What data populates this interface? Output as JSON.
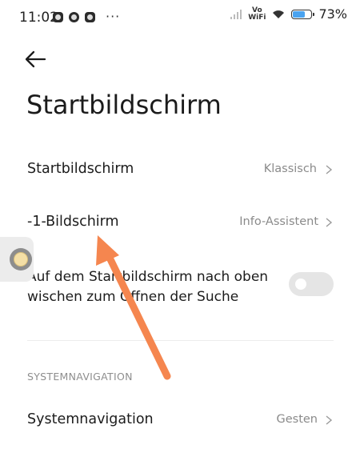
{
  "status_bar": {
    "time": "11:02",
    "more": "···",
    "vo_top": "Vo",
    "vo_bottom": "WiFi",
    "battery_percent": "73%",
    "battery_level": 0.73,
    "icons": [
      "app-notification-icon",
      "record-icon",
      "shazam-icon",
      "signal-icon",
      "vowifi-icon",
      "wifi-icon",
      "battery-icon"
    ]
  },
  "header": {
    "title": "Startbildschirm"
  },
  "settings": {
    "home_screen": {
      "label": "Startbildschirm",
      "value": "Klassisch"
    },
    "minus_one_screen": {
      "label": "-1-Bildschirm",
      "value": "Info-Assistent"
    },
    "swipe_search": {
      "label": "Auf dem Startbildschirm nach oben wischen zum Öffnen der Suche",
      "enabled": false
    }
  },
  "system_navigation": {
    "section_header": "SYSTEMNAVIGATION",
    "label": "Systemnavigation",
    "value": "Gesten"
  },
  "colors": {
    "annotation_arrow": "#F5864F",
    "battery_fill": "#4AA3F0",
    "toggle_off": "#E5E5E5"
  }
}
